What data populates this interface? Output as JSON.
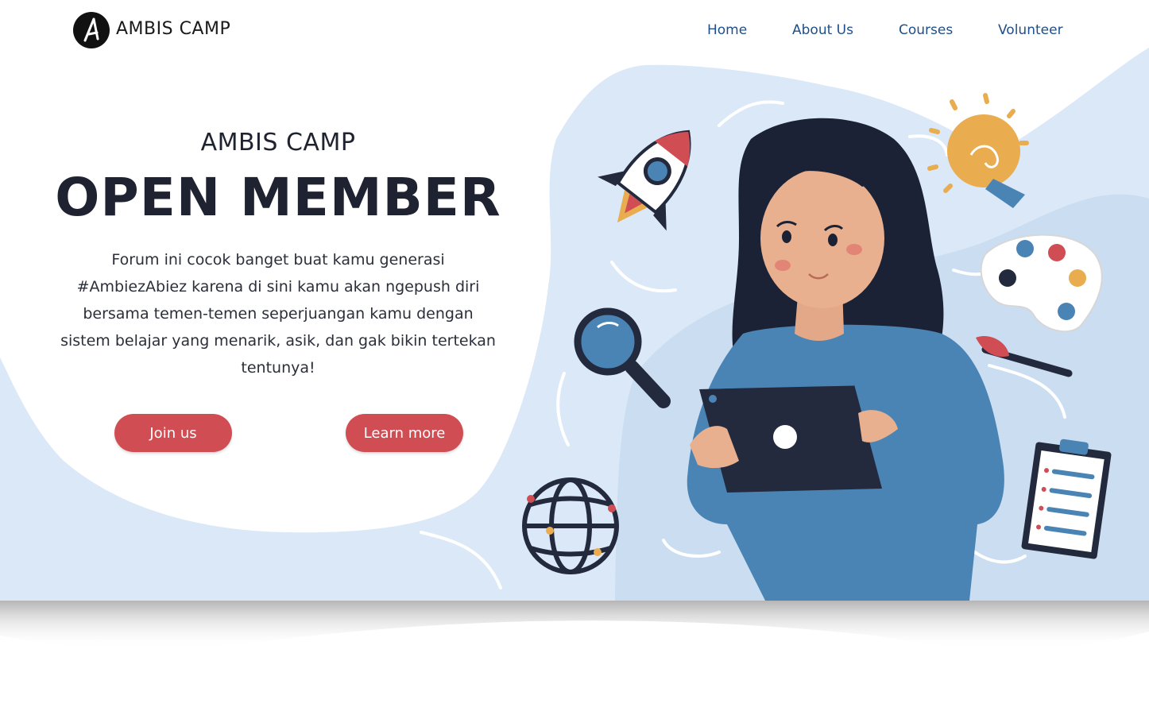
{
  "header": {
    "brand": "AMBIS CAMP",
    "nav": [
      {
        "label": "Home"
      },
      {
        "label": "About Us"
      },
      {
        "label": "Courses"
      },
      {
        "label": "Volunteer"
      }
    ]
  },
  "hero": {
    "eyebrow": "AMBIS CAMP",
    "headline": "OPEN MEMBER",
    "description": "Forum ini cocok banget buat kamu generasi #AmbiezAbiez karena di sini kamu akan ngepush diri bersama temen-temen seperjuangan kamu dengan sistem belajar yang menarik, asik, dan gak bikin tertekan tentunya!",
    "primary_button": "Join us",
    "secondary_button": "Learn more"
  },
  "colors": {
    "accent": "#d14d54",
    "nav_link": "#1e4f8a",
    "background_wave": "#dbe8f7",
    "shirt": "#4a84b5",
    "hair": "#1b2236",
    "tablet": "#232a3d",
    "bulb": "#e9ac4f"
  },
  "illustration": {
    "icons": [
      "rocket-icon",
      "lightbulb-icon",
      "magnifier-icon",
      "paint-palette-icon",
      "paintbrush-icon",
      "globe-icon",
      "clipboard-icon",
      "tablet-icon"
    ]
  }
}
